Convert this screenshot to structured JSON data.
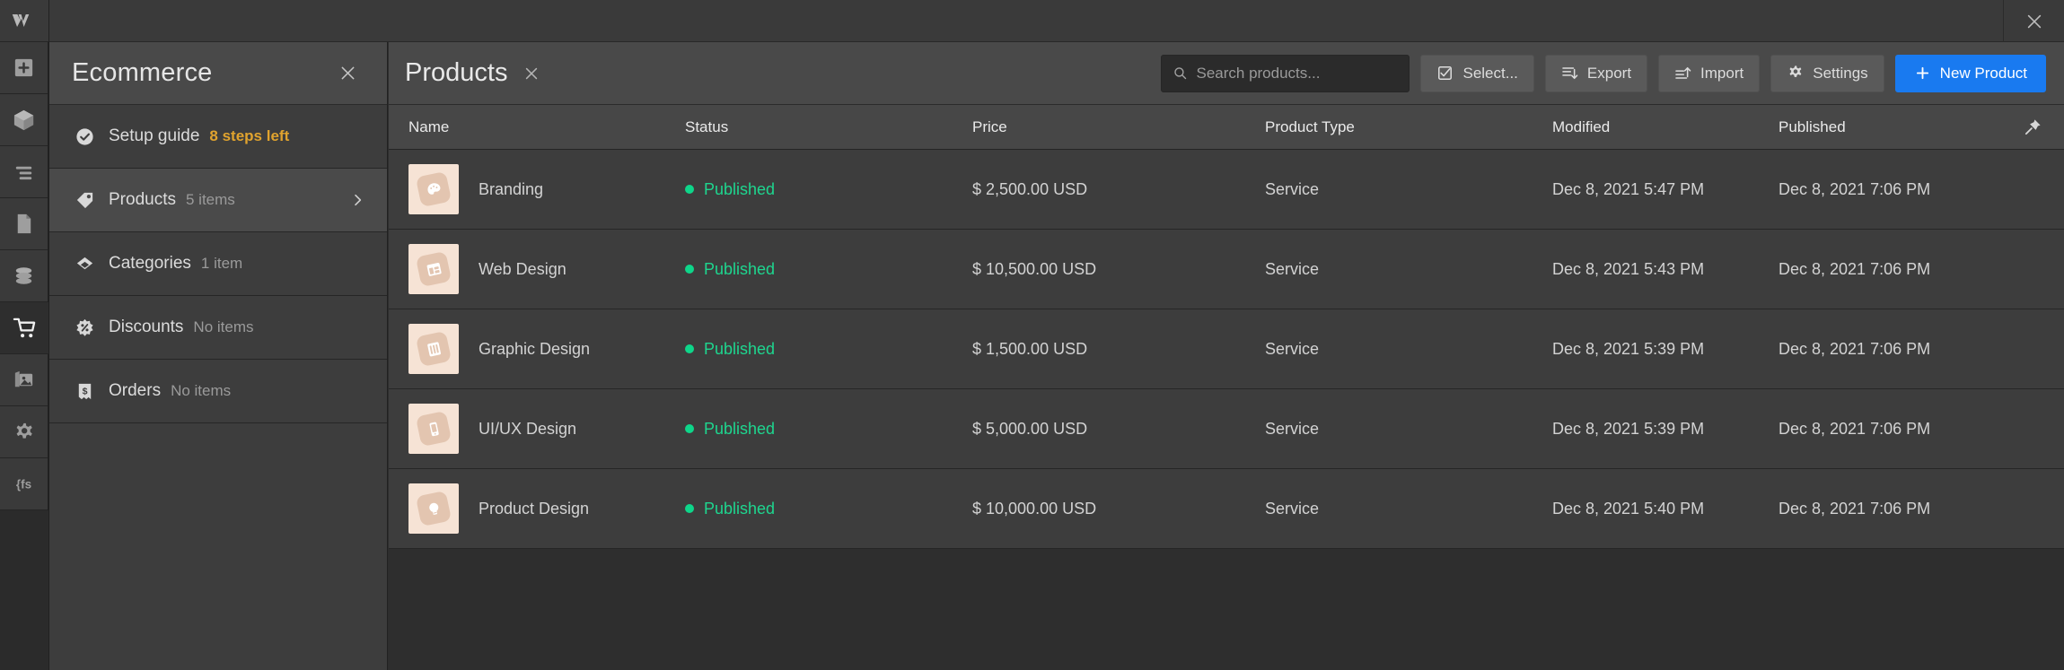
{
  "window": {
    "close_label": "×"
  },
  "rail": {
    "logo_name": "webflow-logo",
    "items": [
      {
        "name": "add-elements",
        "icon": "plus-square-icon"
      },
      {
        "name": "components",
        "icon": "cube-icon"
      },
      {
        "name": "navigator",
        "icon": "navigator-lines-icon"
      },
      {
        "name": "pages",
        "icon": "page-document-icon"
      },
      {
        "name": "cms",
        "icon": "database-icon"
      },
      {
        "name": "ecommerce",
        "icon": "shopping-cart-icon"
      },
      {
        "name": "assets",
        "icon": "assets-images-icon"
      },
      {
        "name": "settings",
        "icon": "gear-icon"
      },
      {
        "name": "code",
        "icon": "code-fs-icon"
      }
    ]
  },
  "panel": {
    "title": "Ecommerce",
    "close_label": "×",
    "items": [
      {
        "label": "Setup guide",
        "meta": "8 steps left",
        "meta_style": "warn",
        "icon": "check-circle-icon",
        "selected": false,
        "chevron": false
      },
      {
        "label": "Products",
        "meta": "5 items",
        "meta_style": "muted",
        "icon": "tag-icon",
        "selected": true,
        "chevron": true
      },
      {
        "label": "Categories",
        "meta": "1 item",
        "meta_style": "muted",
        "icon": "diamond-icon",
        "selected": false,
        "chevron": false
      },
      {
        "label": "Discounts",
        "meta": "No items",
        "meta_style": "muted",
        "icon": "discount-badge-icon",
        "selected": false,
        "chevron": false
      },
      {
        "label": "Orders",
        "meta": "No items",
        "meta_style": "muted",
        "icon": "receipt-dollar-icon",
        "selected": false,
        "chevron": false
      }
    ]
  },
  "main": {
    "tab_title": "Products",
    "tab_close_label": "×",
    "search": {
      "placeholder": "Search products...",
      "value": ""
    },
    "buttons": [
      {
        "label": "Select...",
        "icon": "checkbox-check-icon",
        "primary": false
      },
      {
        "label": "Export",
        "icon": "export-down-icon",
        "primary": false
      },
      {
        "label": "Import",
        "icon": "import-up-icon",
        "primary": false
      },
      {
        "label": "Settings",
        "icon": "gear-icon",
        "primary": false
      },
      {
        "label": "New Product",
        "icon": "plus-icon",
        "primary": true
      }
    ],
    "table": {
      "columns": [
        "Name",
        "Status",
        "Price",
        "Product Type",
        "Modified",
        "Published"
      ],
      "pin_icon": "pushpin-icon",
      "rows": [
        {
          "name": "Branding",
          "status": "Published",
          "price": "$ 2,500.00 USD",
          "type": "Service",
          "modified": "Dec 8, 2021 5:47 PM",
          "published": "Dec 8, 2021 7:06 PM",
          "thumb_icon": "palette-icon"
        },
        {
          "name": "Web Design",
          "status": "Published",
          "price": "$ 10,500.00 USD",
          "type": "Service",
          "modified": "Dec 8, 2021 5:43 PM",
          "published": "Dec 8, 2021 7:06 PM",
          "thumb_icon": "layout-icon"
        },
        {
          "name": "Graphic Design",
          "status": "Published",
          "price": "$ 1,500.00 USD",
          "type": "Service",
          "modified": "Dec 8, 2021 5:39 PM",
          "published": "Dec 8, 2021 7:06 PM",
          "thumb_icon": "pen-ruler-icon"
        },
        {
          "name": "UI/UX Design",
          "status": "Published",
          "price": "$ 5,000.00 USD",
          "type": "Service",
          "modified": "Dec 8, 2021 5:39 PM",
          "published": "Dec 8, 2021 7:06 PM",
          "thumb_icon": "mobile-screen-icon"
        },
        {
          "name": "Product Design",
          "status": "Published",
          "price": "$ 10,000.00 USD",
          "type": "Service",
          "modified": "Dec 8, 2021 5:40 PM",
          "published": "Dec 8, 2021 7:06 PM",
          "thumb_icon": "lightbulb-icon"
        }
      ]
    }
  },
  "colors": {
    "accent_blue": "#197af0",
    "status_green": "#1ed68f",
    "warning_amber": "#e0a32e",
    "panel_bg": "#3d3d3d",
    "header_bg": "#494949"
  }
}
